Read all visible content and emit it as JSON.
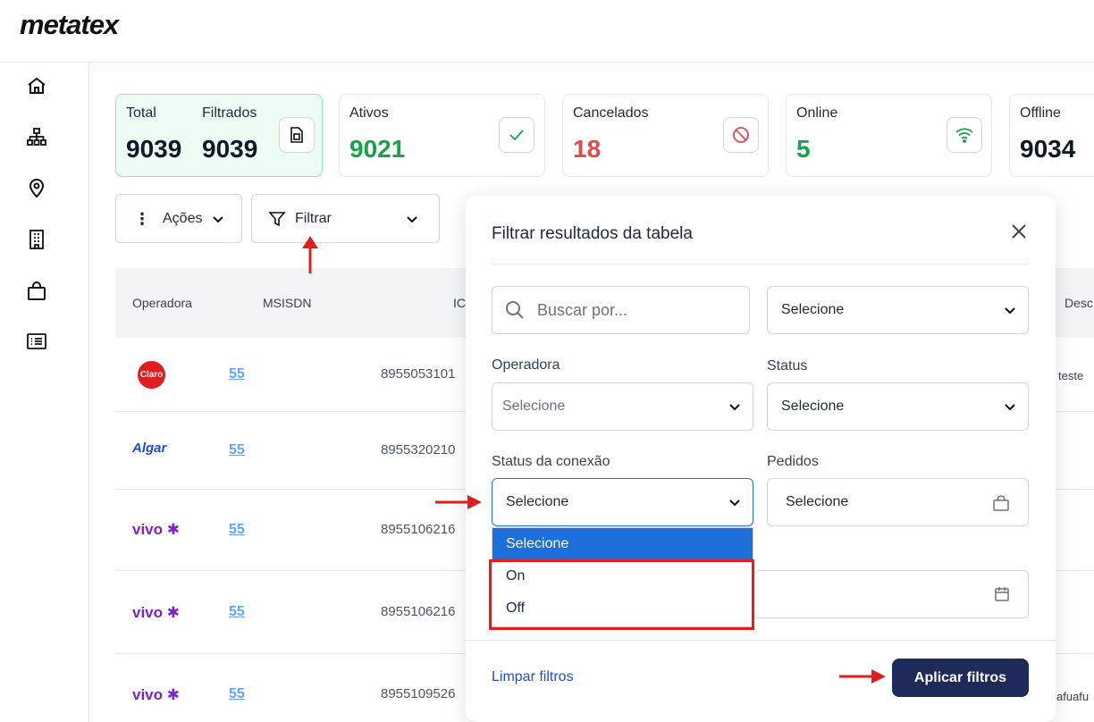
{
  "header": {
    "logo": "metatex"
  },
  "sidebar": {
    "icons": [
      "home-icon",
      "org-chart-icon",
      "location-pin-icon",
      "building-icon",
      "shopping-bag-icon",
      "list-icon"
    ]
  },
  "stats": {
    "total_label": "Total",
    "total_value": "9039",
    "filtered_label": "Filtrados",
    "filtered_value": "9039",
    "active_label": "Ativos",
    "active_value": "9021",
    "cancelled_label": "Cancelados",
    "cancelled_value": "18",
    "online_label": "Online",
    "online_value": "5",
    "offline_label": "Offline",
    "offline_value": "9034"
  },
  "toolbar": {
    "actions_label": "Ações",
    "filter_label": "Filtrar"
  },
  "table": {
    "headers": {
      "operadora": "Operadora",
      "msisdn": "MSISDN",
      "iccid": "IC",
      "desc": "Desc"
    },
    "rows": [
      {
        "operator": "Claro",
        "msisdn": "55",
        "iccid": "8955053101",
        "desc": "teste"
      },
      {
        "operator": "Algar",
        "msisdn": "55",
        "iccid": "8955320210",
        "desc": ""
      },
      {
        "operator": "vivo",
        "msisdn": "55",
        "iccid": "8955106216",
        "desc": ""
      },
      {
        "operator": "vivo",
        "msisdn": "55",
        "iccid": "8955106216",
        "desc": ""
      },
      {
        "operator": "vivo",
        "msisdn": "55",
        "iccid": "8955109526",
        "desc": "afuafu"
      }
    ]
  },
  "modal": {
    "title": "Filtrar resultados da tabela",
    "search_placeholder": "Buscar por...",
    "search_type_value": "Selecione",
    "operadora_label": "Operadora",
    "operadora_value": "Selecione",
    "status_label": "Status",
    "status_value": "Selecione",
    "conexao_label": "Status da conexão",
    "conexao_value": "Selecione",
    "pedidos_label": "Pedidos",
    "pedidos_value": "Selecione",
    "conexao_options": [
      "Selecione",
      "On",
      "Off"
    ],
    "clear_label": "Limpar filtros",
    "apply_label": "Aplicar filtros"
  },
  "colors": {
    "accent": "#1d6fdc",
    "apply_bg": "#1e2a5a",
    "active_green": "#16a34a",
    "cancel_red": "#e5484d",
    "annotation_red": "#e11d1d"
  }
}
